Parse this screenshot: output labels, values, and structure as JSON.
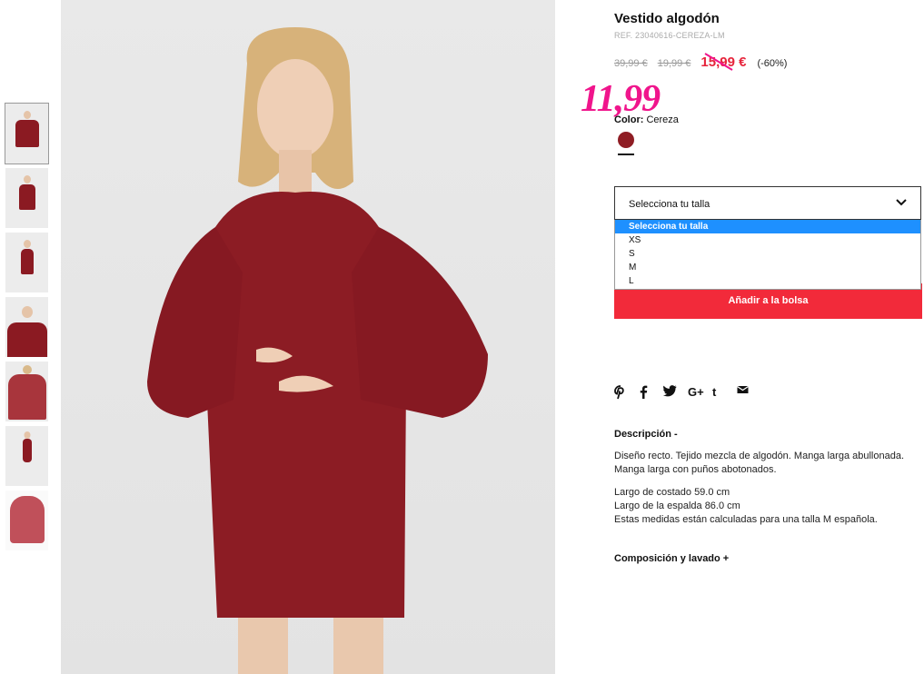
{
  "product": {
    "title": "Vestido algodón",
    "ref": "REF. 23040616-CEREZA-LM",
    "prices": {
      "original": "39,99 €",
      "previous": "19,99 €",
      "current": "15,99 €",
      "discount": "(-60%)",
      "annotation": "11,99"
    },
    "color_label": "Color:",
    "color_value": "Cereza",
    "swatch_color": "#8f1d24"
  },
  "size_select": {
    "label": "Selecciona tu talla",
    "options": [
      "Selecciona tu talla",
      "XS",
      "S",
      "M",
      "L"
    ]
  },
  "add_to_bag": "Añadir a la bolsa",
  "share": [
    "pinterest-icon",
    "facebook-icon",
    "twitter-icon",
    "google-plus-icon",
    "tumblr-icon",
    "email-icon"
  ],
  "description": {
    "title": "Descripción -",
    "text": "Diseño recto. Tejido mezcla de algodón. Manga larga abullonada. Manga larga con puños abotonados.",
    "measure_1": "Largo de costado 59.0 cm",
    "measure_2": "Largo de la espalda 86.0 cm",
    "measure_3": "Estas medidas están calculadas para una talla M española."
  },
  "composition_title": "Composición y lavado +",
  "colors": {
    "accent_red": "#f22a3a",
    "annotation_pink": "#f0158c",
    "selected_option": "#1e90ff"
  }
}
